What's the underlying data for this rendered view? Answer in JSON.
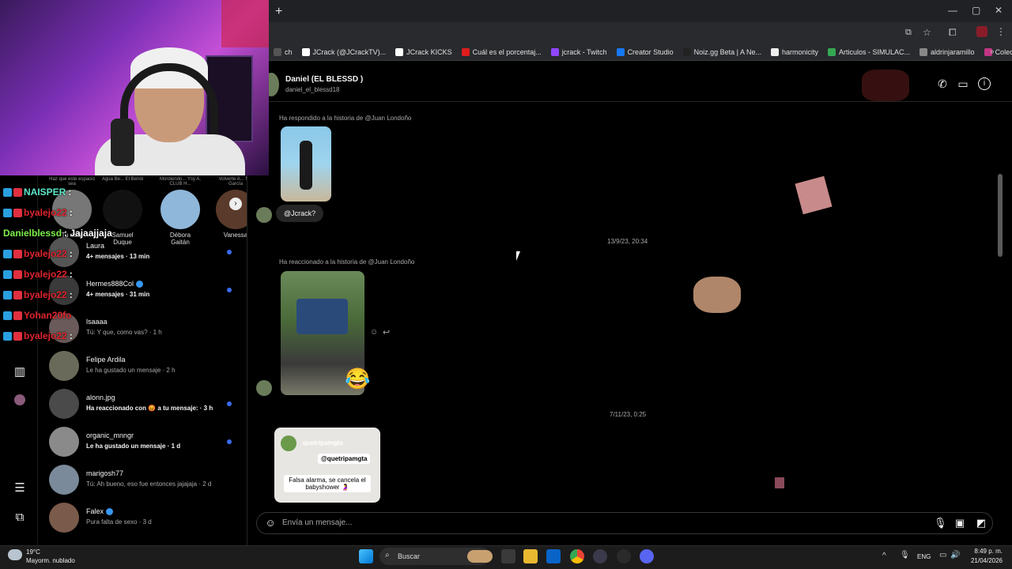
{
  "browser": {
    "new_tab": "+",
    "window_controls": [
      "—",
      "▢",
      "✕"
    ],
    "bookmarks": [
      {
        "label": "ch",
        "color": "#555555"
      },
      {
        "label": "JCrack (@JCrackTV)...",
        "color": "#ffffff"
      },
      {
        "label": "JCrack KICKS",
        "color": "#ffffff"
      },
      {
        "label": "Cuál es el porcentaj...",
        "color": "#e01c1c"
      },
      {
        "label": "jcrack - Twitch",
        "color": "#9146ff"
      },
      {
        "label": "Creator Studio",
        "color": "#1877f2"
      },
      {
        "label": "Noiz.gg Beta | A Ne...",
        "color": "#222222"
      },
      {
        "label": "harmonicity",
        "color": "#eeeeee"
      },
      {
        "label": "Articulos - SIMULAC...",
        "color": "#34a853"
      },
      {
        "label": "aldrinjaramillo",
        "color": "#888888"
      },
      {
        "label": "Colección de M_blei...",
        "color": "#c13584"
      }
    ]
  },
  "stream_chat": [
    {
      "user": "NAISPER",
      "text": ":",
      "color": "#5ee6c8"
    },
    {
      "user": "byalejo22",
      "text": ":",
      "color": "#e0242e"
    },
    {
      "user": "Danielblessd",
      "text": ": Jajaajjaja",
      "color": "#7cf04a"
    },
    {
      "user": "byalejo22",
      "text": ":",
      "color": "#e0242e"
    },
    {
      "user": "byalejo22",
      "text": ":",
      "color": "#e0242e"
    },
    {
      "user": "byalejo22",
      "text": ":",
      "color": "#e0242e"
    },
    {
      "user": "Yohan20fo",
      "text": "",
      "color": "#e0242e"
    },
    {
      "user": "byalejo22",
      "text": ":",
      "color": "#e0242e"
    }
  ],
  "stories": [
    {
      "note": "Haz que este espacio sea",
      "name": "Tu nota",
      "color": "#777777"
    },
    {
      "note": "Agua Be... El Bendi",
      "name": "Samuel Duque",
      "color": "#111111"
    },
    {
      "note": "Mordiendo... Ysy A, CLUB H...",
      "name": "Débora Gaitán",
      "color": "#8fb7d9"
    },
    {
      "note": "Volverte A... Nio García",
      "name": "Vanessa",
      "color": "#5a3a2a"
    }
  ],
  "conversations": [
    {
      "name": "Laura",
      "msg": "4+ mensajes · 13 min",
      "bold": true,
      "dot": true,
      "color": "#555555",
      "verified": false
    },
    {
      "name": "Hermes888Col",
      "msg": "4+ mensajes · 31 min",
      "bold": true,
      "dot": true,
      "color": "#3a3a3a",
      "verified": true
    },
    {
      "name": "lsaaaa",
      "msg": "Tú: Y que, como vas? · 1 h",
      "bold": false,
      "dot": false,
      "color": "#6a5a5a",
      "verified": false
    },
    {
      "name": "Felipe Ardila",
      "msg": "Le ha gustado un mensaje · 2 h",
      "bold": false,
      "dot": false,
      "color": "#6a6a5a",
      "verified": false
    },
    {
      "name": "alonn.jpg",
      "msg": "Ha reaccionado con 😡 a tu mensaje: · 3 h",
      "bold": true,
      "dot": true,
      "color": "#4a4a4a",
      "verified": false
    },
    {
      "name": "organic_mnngr",
      "msg": "Le ha gustado un mensaje · 1 d",
      "bold": true,
      "dot": true,
      "color": "#8a8a8a",
      "verified": false
    },
    {
      "name": "marigosh77",
      "msg": "Tú: Ah bueno, eso fue entonces jajajaja · 2 d",
      "bold": false,
      "dot": false,
      "color": "#7a8a9a",
      "verified": false
    },
    {
      "name": "Falex",
      "msg": "Pura falta de sexo · 3 d",
      "bold": false,
      "dot": false,
      "color": "#7a5a4a",
      "verified": true
    }
  ],
  "chat": {
    "name": "Daniel (EL BLESSD )",
    "username": "daniel_el_blessd18",
    "reply_label_1": "Ha respondido a la historia de @Juan Londoño",
    "message_1": "@Jcrack?",
    "timestamp_1": "13/9/23, 20:34",
    "reply_label_2": "Ha reaccionado a la historia de @Juan Londoño",
    "reaction_emoji": "😂",
    "timestamp_2": "7/11/23, 0:25",
    "shared_post_user": "quetripamgta",
    "shared_post_tag": "@quetripamgta",
    "shared_post_caption": "Falsa alarma, se cancela el babyshower 🤰",
    "composer_placeholder": "Envía un mensaje..."
  },
  "taskbar": {
    "temperature": "19°C",
    "weather": "Mayorm. nublado",
    "search": "Buscar",
    "language": "ENG",
    "time": "8:49 p. m.",
    "date": "21/04/2026"
  }
}
